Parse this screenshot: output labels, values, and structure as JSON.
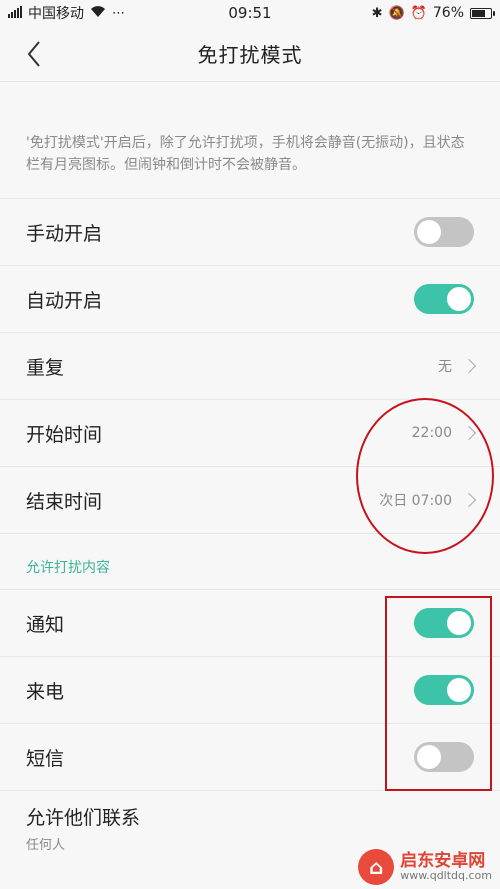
{
  "status_bar": {
    "carrier": "中国移动",
    "time": "09:51",
    "battery_percent": "76%",
    "battery_level": 0.76
  },
  "nav": {
    "title": "免打扰模式"
  },
  "description": "'免打扰模式'开启后，除了允许打扰项，手机将会静音(无振动)，且状态栏有月亮图标。但闹钟和倒计时不会被静音。",
  "settings": {
    "manual": {
      "label": "手动开启",
      "enabled": false
    },
    "auto": {
      "label": "自动开启",
      "enabled": true
    },
    "repeat": {
      "label": "重复",
      "value": "无"
    },
    "start": {
      "label": "开始时间",
      "value": "22:00"
    },
    "end": {
      "label": "结束时间",
      "value": "次日 07:00"
    }
  },
  "allowed_section": {
    "title": "允许打扰内容",
    "notify": {
      "label": "通知",
      "enabled": true
    },
    "call": {
      "label": "来电",
      "enabled": true
    },
    "sms": {
      "label": "短信",
      "enabled": false
    },
    "contacts": {
      "label": "允许他们联系",
      "value": "任何人"
    }
  },
  "watermark": {
    "name": "启东安卓网",
    "url": "www.qdltdq.com"
  },
  "colors": {
    "accent": "#3cc3a8",
    "toggle_off": "#c4c4c4",
    "annotation": "#c8121b"
  }
}
